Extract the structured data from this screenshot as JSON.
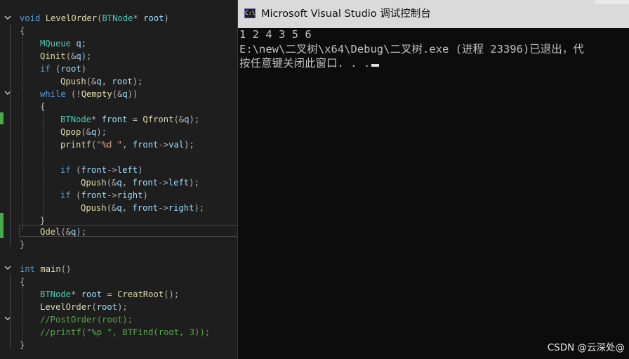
{
  "editor": {
    "lines": [
      [
        "void",
        " ",
        "LevelOrder",
        "(",
        "BTNode",
        "* ",
        "root",
        ")"
      ],
      [
        "{"
      ],
      [
        "MQueue",
        " ",
        "q",
        ";"
      ],
      [
        "Qinit",
        "(&",
        "q",
        ");"
      ],
      [
        "if",
        " (",
        "root",
        ")"
      ],
      [
        "Qpush",
        "(&",
        "q",
        ", ",
        "root",
        ");"
      ],
      [
        "while",
        " (!",
        "Qempty",
        "(&",
        "q",
        "))"
      ],
      [
        "{"
      ],
      [
        "BTNode",
        "* ",
        "front",
        " = ",
        "Qfront",
        "(&",
        "q",
        ");"
      ],
      [
        "Qpop",
        "(&",
        "q",
        ");"
      ],
      [
        "printf",
        "(",
        "\"%d \"",
        ", ",
        "front",
        "->",
        "val",
        ");"
      ],
      [],
      [
        "if",
        " (",
        "front",
        "->",
        "left",
        ")"
      ],
      [
        "Qpush",
        "(&",
        "q",
        ", ",
        "front",
        "->",
        "left",
        ");"
      ],
      [
        "if",
        " (",
        "front",
        "->",
        "right",
        ")"
      ],
      [
        "Qpush",
        "(&",
        "q",
        ", ",
        "front",
        "->",
        "right",
        ");"
      ],
      [
        "}"
      ],
      [
        "Qdel",
        "(&",
        "q",
        ");"
      ],
      [
        "}"
      ],
      [],
      [
        "int",
        " ",
        "main",
        "()"
      ],
      [
        "{"
      ],
      [
        "BTNode",
        "* ",
        "root",
        " = ",
        "CreatRoot",
        "();"
      ],
      [
        "LevelOrder",
        "(",
        "root",
        ");"
      ],
      [
        "//PostOrder(root);"
      ],
      [
        "//printf(\"%p \", BTFind(root, 3));"
      ],
      [
        "}"
      ]
    ]
  },
  "console": {
    "title": "Microsoft Visual Studio 调试控制台",
    "icon_text": "C:\\",
    "output": [
      "1 2 4 3 5 6",
      "E:\\new\\二叉树\\x64\\Debug\\二叉树.exe (进程 23396)已退出，代",
      "按任意键关闭此窗口. . ."
    ]
  },
  "watermark": "CSDN @云深处@",
  "colors": {
    "editor_bg": "#1e1e1e",
    "console_bg": "#0c0c0c",
    "keyword": "#569cd6",
    "type": "#4ec9b0",
    "function": "#dcdcaa",
    "variable": "#9cdcfe",
    "string": "#d69d85",
    "comment": "#57a64a",
    "change_marker": "#4aaa4a"
  }
}
